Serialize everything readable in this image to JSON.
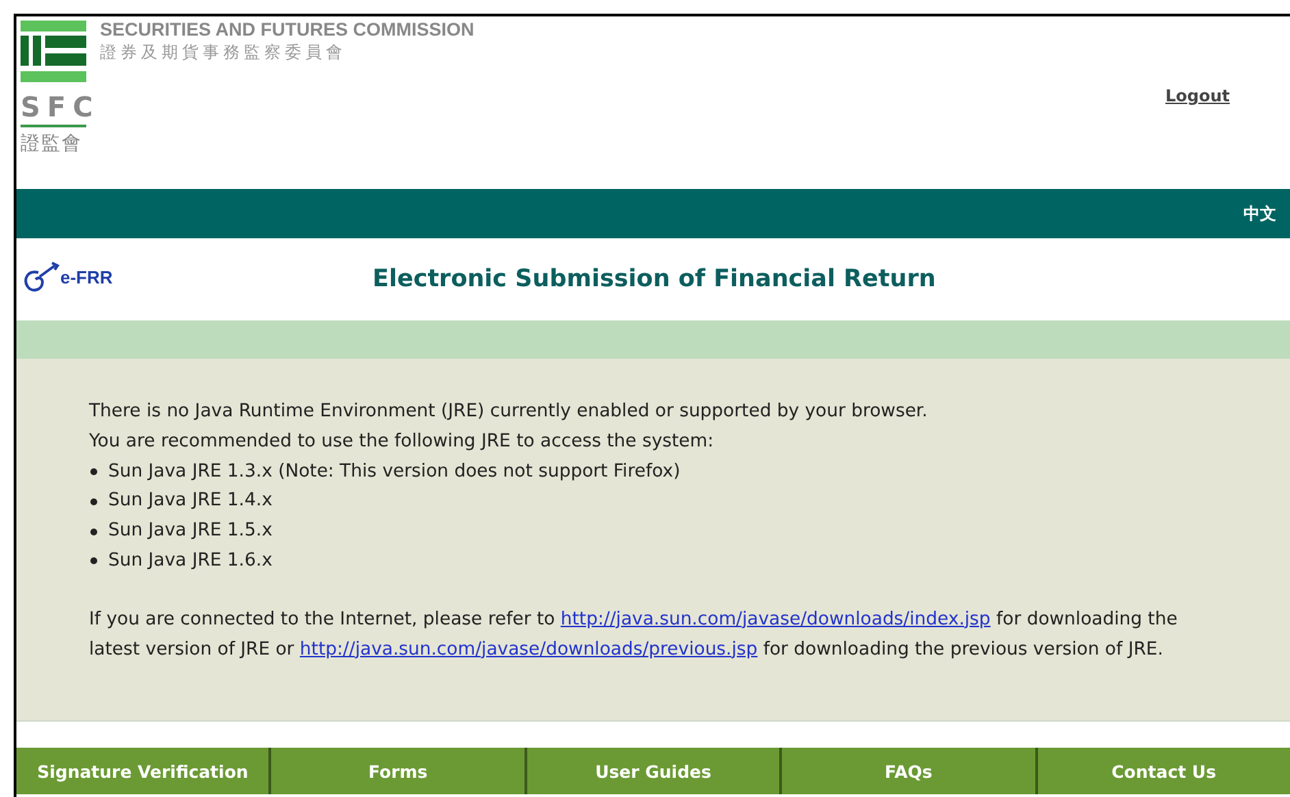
{
  "header": {
    "org_name": "SECURITIES AND FUTURES COMMISSION",
    "org_name_chinese": "證券及期貨事務監察委員會",
    "logo_abbr": "SFC",
    "logo_abbr_chinese": "證監會",
    "logout": "Logout"
  },
  "language_bar": {
    "link": "中文"
  },
  "title_bar": {
    "logo_text": "e-FRR",
    "title": "Electronic Submission of Financial Return"
  },
  "message": {
    "lines": [
      "There is no Java Runtime Environment (JRE) currently enabled or supported by your browser.",
      "You are recommended to use the following JRE to access the system:"
    ],
    "items": [
      "Sun Java JRE 1.3.x (Note: This version does not support Firefox)",
      "Sun Java JRE 1.4.x",
      "Sun Java JRE 1.5.x",
      "Sun Java JRE 1.6.x"
    ],
    "download_note": [
      {
        "kind": "text",
        "text": "If you are connected to the Internet, please refer to "
      },
      {
        "kind": "link",
        "text": "http://java.sun.com/javase/downloads/index.jsp"
      },
      {
        "kind": "text",
        "text": " for downloading the latest version of JRE or "
      },
      {
        "kind": "link",
        "text": "http://java.sun.com/javase/downloads/previous.jsp"
      },
      {
        "kind": "text",
        "text": " for downloading the previous version of JRE."
      }
    ]
  },
  "footer_nav": [
    "Signature Verification",
    "Forms",
    "User Guides",
    "FAQs",
    "Contact Us"
  ]
}
